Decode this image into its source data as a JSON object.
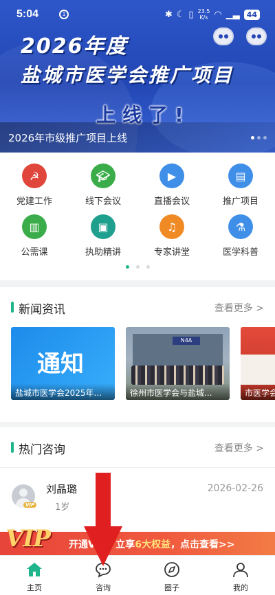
{
  "status_bar": {
    "time": "5:04",
    "network_speed_value": "23.5",
    "network_speed_unit": "K/s",
    "battery": "44"
  },
  "banner": {
    "title_year": "2026年度",
    "title_org": "盐城市医学会推广项目",
    "title_live": "上线了!",
    "caption": "2026年市级推广项目上线",
    "slide_count": 3,
    "active_slide": 1
  },
  "grid": {
    "items": [
      {
        "label": "党建工作",
        "icon": "party-building-icon",
        "color": "#e0463b"
      },
      {
        "label": "线下会议",
        "icon": "graduation-cap-icon",
        "color": "#3aad4a"
      },
      {
        "label": "直播会议",
        "icon": "live-tv-icon",
        "color": "#3f8ee8"
      },
      {
        "label": "推广项目",
        "icon": "book-icon",
        "color": "#3f8ee8"
      },
      {
        "label": "公需课",
        "icon": "open-book-icon",
        "color": "#3aad4a"
      },
      {
        "label": "执助精讲",
        "icon": "certificate-icon",
        "color": "#1f9f8e"
      },
      {
        "label": "专家讲堂",
        "icon": "headphones-icon",
        "color": "#f08a24"
      },
      {
        "label": "医学科普",
        "icon": "microscope-icon",
        "color": "#3f8ee8"
      }
    ],
    "page_count": 3,
    "active_page": 0
  },
  "news": {
    "title": "新闻资讯",
    "more": "查看更多 >",
    "cards": [
      {
        "caption": "盐城市医学会2025年...",
        "image_text": "通知"
      },
      {
        "caption": "徐州市医学会与盐城...",
        "image_text": "N4A"
      },
      {
        "caption": "市医学会"
      }
    ]
  },
  "hot": {
    "title": "热门咨询",
    "more": "查看更多 >",
    "items": [
      {
        "name": "刘晶璐",
        "age": "1岁",
        "date": "2026-02-26",
        "badge": "VIP"
      }
    ]
  },
  "vip_banner": {
    "logo": "VIP",
    "text_prefix": "开通",
    "text_mid": "VIP，立享",
    "text_highlight": "6大权益",
    "text_suffix": "，点击查看>>"
  },
  "tabs": [
    {
      "label": "主页",
      "icon": "home-icon",
      "active": true
    },
    {
      "label": "咨询",
      "icon": "chat-bubble-icon",
      "active": false
    },
    {
      "label": "圈子",
      "icon": "circle-compass-icon",
      "active": false
    },
    {
      "label": "我的",
      "icon": "person-icon",
      "active": false
    }
  ],
  "colors": {
    "accent": "#1fb58a",
    "banner_blue": "#2246b4",
    "vip_red": "#e8443a",
    "annotation_arrow": "#e02020"
  }
}
